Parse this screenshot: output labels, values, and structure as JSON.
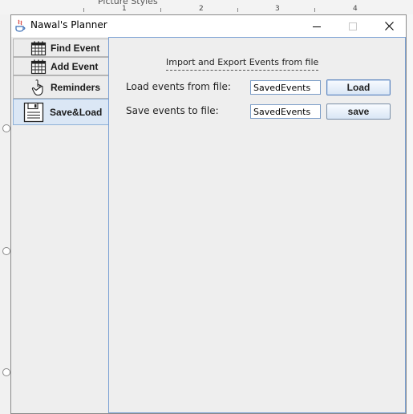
{
  "host": {
    "ribbon_label": "Picture Styles",
    "ruler_numbers": [
      "1",
      "2",
      "3",
      "4"
    ]
  },
  "window": {
    "title": "Nawal's Planner",
    "controls": {
      "minimize_icon": "minimize-icon",
      "maximize_icon": "maximize-icon",
      "close_icon": "close-icon"
    }
  },
  "sidebar": {
    "tabs": [
      {
        "label": "Find Event",
        "icon": "calendar-icon",
        "selected": false
      },
      {
        "label": "Add Event",
        "icon": "calendar-icon",
        "selected": false
      },
      {
        "label": "Reminders",
        "icon": "hand-pointer-icon",
        "selected": false
      },
      {
        "label": "Save&Load",
        "icon": "document-save-icon",
        "selected": true
      }
    ]
  },
  "panel": {
    "title": "Import and Export Events from file",
    "load": {
      "label": "Load events from file:",
      "value": "SavedEvents",
      "button": "Load"
    },
    "save": {
      "label": "Save events to file:",
      "value": "SavedEvents",
      "button": "save"
    }
  },
  "colors": {
    "accent": "#7aa0d4",
    "selected_tab": "#dbe7f5",
    "panel_bg": "#eeeeee"
  }
}
